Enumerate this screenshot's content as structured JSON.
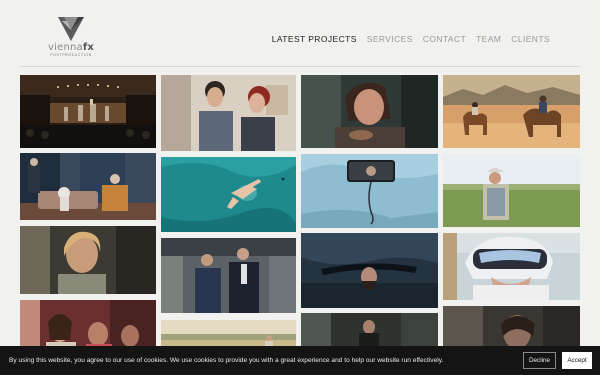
{
  "brand": {
    "logo_name": "vienna-fx-logo",
    "word_light": "vienna",
    "word_bold": "fx",
    "subtitle": "POSTPRODUCTION"
  },
  "nav": {
    "items": [
      {
        "label": "LATEST PROJECTS",
        "active": true
      },
      {
        "label": "SERVICES",
        "active": false
      },
      {
        "label": "CONTACT",
        "active": false
      },
      {
        "label": "TEAM",
        "active": false
      },
      {
        "label": "CLIENTS",
        "active": false
      }
    ]
  },
  "cookie": {
    "text": "By using this website, you agree to our use of cookies. We use cookies to provide you with a great experience and to help our website run effectively.",
    "decline_label": "Decline",
    "accept_label": "Accept"
  },
  "colors": {
    "background": "#f1f1ef",
    "nav_active": "#222222",
    "nav_inactive": "#9a9a9a",
    "cookie_bg": "#141414"
  }
}
